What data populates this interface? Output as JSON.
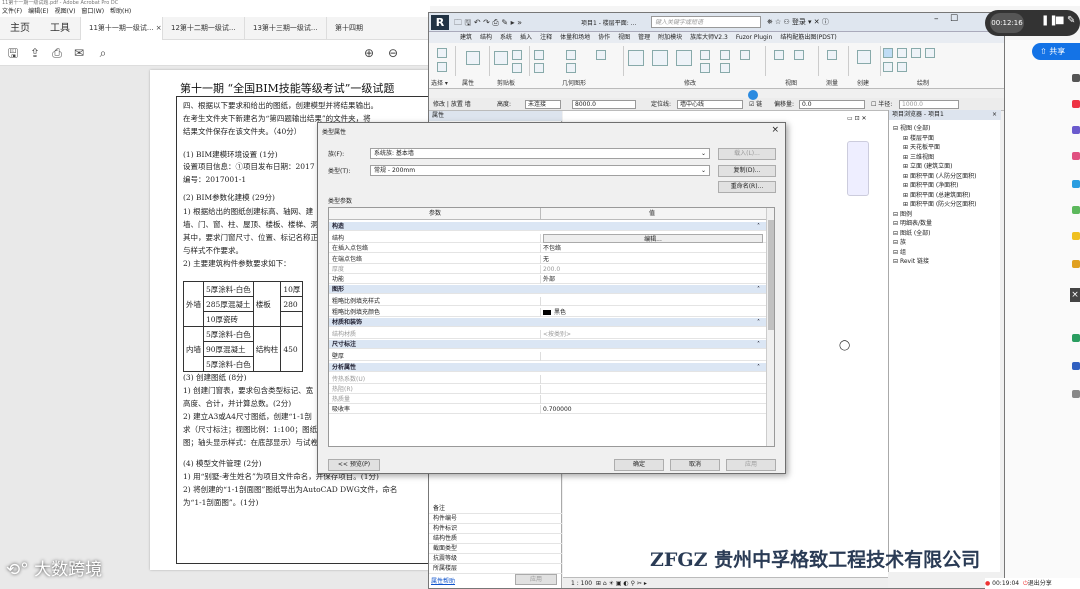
{
  "acrobat": {
    "title": "11第十一期一级试题.pdf - Adobe Acrobat Pro DC",
    "menu": [
      "文件(F)",
      "编辑(E)",
      "视图(V)",
      "窗口(W)",
      "帮助(H)"
    ],
    "nav_tabs": [
      "主页",
      "工具"
    ],
    "doc_tabs": [
      "11第十一期一级试... ×",
      "12第十二期一级试...",
      "13第十三期一级试...",
      "第十四期"
    ],
    "share": "共享"
  },
  "document": {
    "title": "第十一期 “全国BIM技能等级考试”一级试题",
    "lines": [
      "四、根据以下要求和给出的图纸，创建模型并将结果输出。",
      "在考生文件夹下新建名为“第四题输出结果”的文件夹，将",
      "结果文件保存在该文件夹。（40分）",
      "(1) BIM建模环境设置 (1分)",
      "设置项目信息：①项目发布日期：2017",
      "编号：2017001-1",
      "(2) BIM参数化建模 (29分)",
      "1) 根据给出的图纸创建标高、轴网、建",
      "墙、门、窗、柱、屋顶、楼板、楼梯、洞",
      "其中，要求门窗尺寸、位置、标记名称正",
      "与样式不作要求。",
      "2) 主要建筑构件参数要求如下：",
      "(3) 创建图纸 (8分)",
      "1) 创建门窗表，要求包含类型标记、宽",
      "高度、合计，并计算总数。(2分)",
      "2) 建立A3或A4尺寸图纸，创建“1-1剖",
      "求（尺寸标注；视图比例：1:100；图纸",
      "图；轴头显示样式：在底部显示）与试卷",
      "(4) 模型文件管理 (2分)",
      "1) 用“别墅-考生姓名”为项目文件命名，并保存项目。(1分)",
      "2) 将创建的“1-1剖面图”图纸导出为AutoCAD DWG文件，命名",
      "为“1-1剖面图”。(1分)"
    ],
    "table": {
      "outer": "外墙",
      "inner": "内墙",
      "floor": "楼板",
      "column": "结构柱",
      "cells": [
        "5厚涂料-白色",
        "285厚混凝土",
        "10厚瓷砖",
        "5厚涂料-白色",
        "90厚混凝土",
        "5厚涂料-白色",
        "10厚",
        "280",
        "450"
      ]
    }
  },
  "revit": {
    "title": "项目1 - 楼层平面: ...",
    "search_placeholder": "键入关键字或短语",
    "login": "登录",
    "ribbon_tabs": [
      "建筑",
      "结构",
      "系统",
      "插入",
      "注释",
      "体量和场地",
      "协作",
      "视图",
      "管理",
      "附加模块",
      "族库大师V2.3",
      "Fuzor Plugin",
      "结构配筋出图(PDST)"
    ],
    "ribbon_groups": [
      "选择 ▾",
      "属性",
      "剪贴板",
      "几何图形",
      "修改",
      "视图",
      "测量",
      "创建",
      "绘制"
    ],
    "options": {
      "label": "修改 | 放置 墙",
      "height_label": "高度:",
      "height_unc": "未连接",
      "height_val": "8000.0",
      "loc_label": "定位线:",
      "loc_val": "墙中心线",
      "chain": "链",
      "offset_label": "偏移量:",
      "offset_val": "0.0",
      "radius_label": "半径:",
      "radius_val": "1000.0"
    },
    "props_title": "属性",
    "props_rows": [
      "备注",
      "构件编号",
      "构件标识",
      "结构性质",
      "截面类型",
      "抗震等级",
      "所属楼层"
    ],
    "props_help": "属性帮助",
    "apply": "应用",
    "scale": "1 : 100",
    "browser_title": "项目浏览器 - 项目1",
    "browser": [
      "视图 (全部)",
      "楼层平面",
      "天花板平面",
      "三维视图",
      "立面 (建筑立面)",
      "面积平面 (人防分区面积)",
      "面积平面 (净面积)",
      "面积平面 (总建筑面积)",
      "面积平面 (防火分区面积)",
      "图例",
      "明细表/数量",
      "图纸 (全部)",
      "族",
      "组",
      "Revit 链接"
    ]
  },
  "dialog": {
    "title": "类型属性",
    "family_label": "族(F):",
    "family_val": "系统族: 基本墙",
    "type_label": "类型(T):",
    "type_val": "常规 - 200mm",
    "load": "载入(L)...",
    "dup": "复制(D)...",
    "rename": "重命名(R)...",
    "params_label": "类型参数",
    "col_param": "参数",
    "col_value": "值",
    "rows": [
      {
        "k": "构造",
        "g": true
      },
      {
        "k": "结构",
        "v": "编辑..."
      },
      {
        "k": "在插入点包络",
        "v": "不包络"
      },
      {
        "k": "在端点包络",
        "v": "无"
      },
      {
        "k": "厚度",
        "v": "200.0",
        "dim": true
      },
      {
        "k": "功能",
        "v": "外部"
      },
      {
        "k": "图形",
        "g": true
      },
      {
        "k": "粗略比例填充样式",
        "v": ""
      },
      {
        "k": "粗略比例填充颜色",
        "v": "黑色"
      },
      {
        "k": "材质和装饰",
        "g": true
      },
      {
        "k": "结构材质",
        "v": "<按类别>",
        "dim": true
      },
      {
        "k": "尺寸标注",
        "g": true
      },
      {
        "k": "壁厚",
        "v": ""
      },
      {
        "k": "分析属性",
        "g": true
      },
      {
        "k": "传热系数(U)",
        "v": "",
        "dim": true
      },
      {
        "k": "热阻(R)",
        "v": "",
        "dim": true
      },
      {
        "k": "热质量",
        "v": "",
        "dim": true
      },
      {
        "k": "吸收率",
        "v": "0.700000"
      }
    ],
    "preview": "<< 预览(P)",
    "ok": "确定",
    "cancel": "取消",
    "apply": "应用"
  },
  "overlay": {
    "timer": "00:12:16",
    "watermark_left": "大数跨境",
    "watermark_right": "ZFGZ 贵州中孚格致工程技术有限公司",
    "status_time": "00:19:04",
    "status_exit": "退出分享"
  }
}
